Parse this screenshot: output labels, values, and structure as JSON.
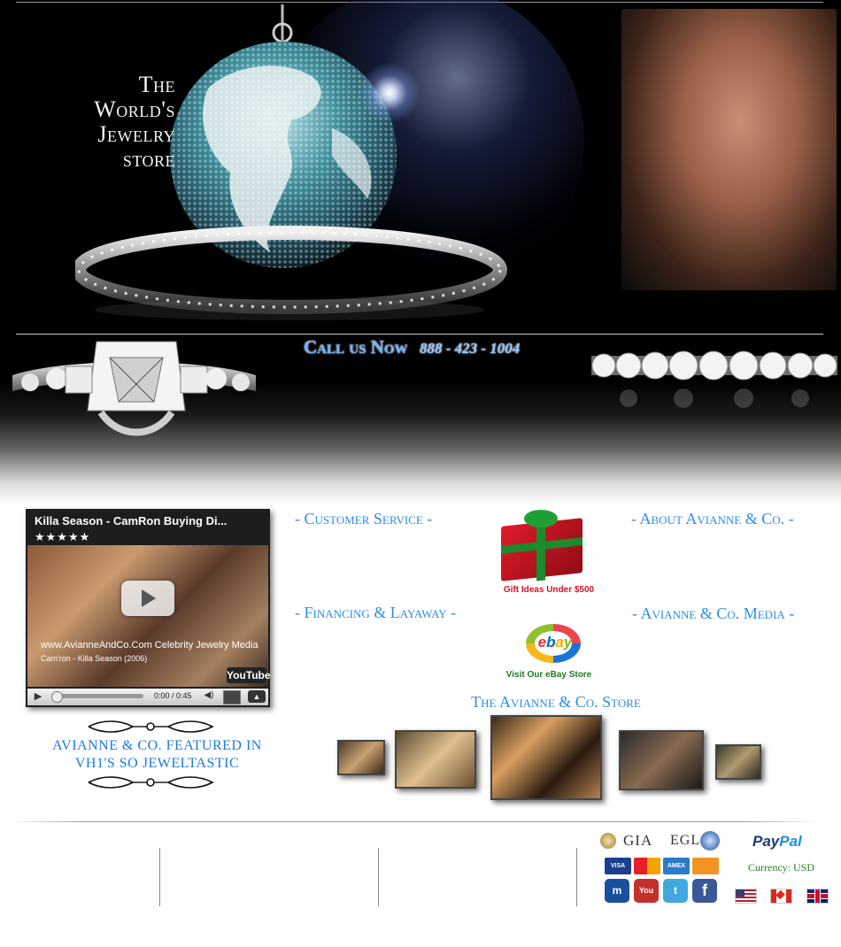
{
  "hero": {
    "tagline": [
      "The",
      "World's",
      "Jewelry",
      "store"
    ],
    "call_label": "Call us Now",
    "phone": "888 - 423 - 1004"
  },
  "video": {
    "title": "Killa Season - CamRon Buying Di...",
    "stars": "★★★★★",
    "caption_main": "www.AvianneAndCo.Com Celebrity Jewelry Media",
    "caption_sub": "Cam'ron - Killa Season (2006)",
    "youtube_logo": "YouTube",
    "time": "0:00 / 0:45",
    "featured_caption_line1": "AVIANNE & CO. FEATURED IN",
    "featured_caption_line2": "VH1'S SO JEWELTASTIC"
  },
  "nav": {
    "customer_service": "- Customer Service -",
    "about": "- About Avianne & Co. -",
    "financing": "- Financing & Layaway -",
    "media": "- Avianne & Co. Media -"
  },
  "promos": {
    "gift_label": "Gift Ideas Under $500",
    "ebay_word": "ebay",
    "ebay_label": "Visit Our eBay Store"
  },
  "store": {
    "title": "The Avianne & Co. Store"
  },
  "footer": {
    "gia": "GIA",
    "egl": "EGL",
    "cards": [
      "VISA",
      "MasterCard",
      "AMEX",
      "DISCOVER"
    ],
    "social": [
      "m",
      "You Tube",
      "t",
      "f"
    ],
    "paypal_pay": "Pay",
    "paypal_pal": "Pal",
    "currency": "Currency: USD"
  },
  "colors": {
    "accent_blue": "#2d8de6",
    "gift_red": "#d4112a",
    "ebay_green": "#1f7a24",
    "currency_green": "#2a7f2a"
  }
}
